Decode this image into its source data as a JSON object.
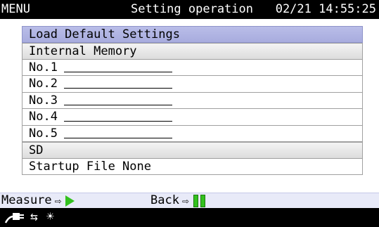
{
  "status_bar": {
    "menu_label": "MENU",
    "screen_title": "Setting operation",
    "datetime": "02/21 14:55:25"
  },
  "panel": {
    "load_default": "Load Default Settings",
    "internal_memory_header": "Internal Memory",
    "memory_slots": [
      "No.1",
      "No.2",
      "No.3",
      "No.4",
      "No.5"
    ],
    "sd_header": "SD",
    "startup_file": "Startup File None"
  },
  "function_bar": {
    "measure_label": "Measure",
    "back_label": "Back",
    "arrow_glyph": "⇨"
  },
  "icons": {
    "play": "play-icon",
    "pause": "pause-icon",
    "cable": "cable-icon",
    "swap": "swap-arrows-icon",
    "brightness": "sun-icon",
    "accent_green": "#33c11e",
    "selection_color": "#b0b4e2"
  }
}
